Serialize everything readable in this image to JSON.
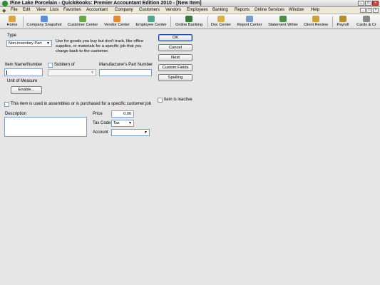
{
  "window": {
    "title": "Pine Lake Porcelain  - QuickBooks: Premier Accountant Edition 2010 - [New Item]",
    "controls": [
      "_",
      "□",
      "×"
    ],
    "mdi_controls": [
      "_",
      "□",
      "×"
    ]
  },
  "menu": {
    "items": [
      "File",
      "Edit",
      "View",
      "Lists",
      "Favorites",
      "Accountant",
      "Company",
      "Customers",
      "Vendors",
      "Employees",
      "Banking",
      "Reports",
      "Online Services",
      "Window",
      "Help"
    ]
  },
  "toolbar": {
    "items": [
      {
        "label": "Home",
        "icon": "home-icon",
        "color": "#d9a441"
      },
      {
        "label": "Company Snapshot",
        "icon": "snapshot-icon",
        "color": "#5a8fd6"
      },
      {
        "label": "Customer Center",
        "icon": "customer-icon",
        "color": "#6aa84f"
      },
      {
        "label": "Vendor Center",
        "icon": "vendor-icon",
        "color": "#e08b3a"
      },
      {
        "label": "Employee Center",
        "icon": "employee-icon",
        "color": "#58a58c"
      },
      {
        "label": "Online Banking",
        "icon": "banking-icon",
        "color": "#3c7a3c"
      },
      {
        "label": "Doc Center",
        "icon": "doc-icon",
        "color": "#d6b04a"
      },
      {
        "label": "Report Center",
        "icon": "report-icon",
        "color": "#7a9acb"
      },
      {
        "label": "Statement Writer",
        "icon": "statement-icon",
        "color": "#4f8d4f"
      },
      {
        "label": "Client Review",
        "icon": "review-icon",
        "color": "#c9a040"
      },
      {
        "label": "Payroll",
        "icon": "payroll-icon",
        "color": "#b58a3a"
      },
      {
        "label": "Cards & Cr",
        "icon": "cards-icon",
        "color": "#8a8a8a"
      }
    ]
  },
  "form": {
    "type_label": "Type",
    "type_value": "Non-inventory Part",
    "type_description": [
      "Use for goods you buy but don't track, like office",
      "supplies, or materials for a specific job that you",
      "charge back to the customer."
    ],
    "item_name_label": "Item Name/Number",
    "item_name_value": "",
    "subitem_label": "Subitem of",
    "subitem_value": "",
    "mfr_part_label": "Manufacturer's Part Number",
    "mfr_part_value": "",
    "uom_label": "Unit of Measure",
    "enable_label": "Enable...",
    "assemblies_label": "This item is used in assemblies or is purchased for a specific customer:job",
    "description_label": "Description",
    "description_value": "",
    "price_label": "Price",
    "price_value": "0.00",
    "tax_code_label": "Tax Code",
    "tax_code_value": "Tax",
    "account_label": "Account",
    "account_value": "",
    "inactive_label": "Item is inactive"
  },
  "buttons": {
    "ok": "OK",
    "cancel": "Cancel",
    "next": "Next",
    "custom_fields": "Custom Fields",
    "spelling": "Spelling"
  },
  "colors": {
    "form_bg": "#e6e6e6",
    "field_border": "#7f9db9",
    "default_button_border": "#1e3f8a"
  }
}
